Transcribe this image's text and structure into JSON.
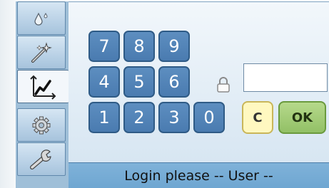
{
  "sidebar": {
    "items": [
      {
        "icon": "drops-icon",
        "active": false
      },
      {
        "icon": "magic-wand-icon",
        "active": false
      },
      {
        "icon": "line-chart-icon",
        "active": true
      },
      {
        "icon": "gear-icon",
        "active": false
      },
      {
        "icon": "wrench-icon",
        "active": false
      }
    ]
  },
  "keypad": {
    "keys": [
      "7",
      "8",
      "9",
      "4",
      "5",
      "6",
      "1",
      "2",
      "3",
      "0"
    ]
  },
  "login": {
    "lock_icon": "lock-icon",
    "password_value": "",
    "clear_label": "C",
    "ok_label": "OK"
  },
  "status": {
    "message": "Login please -- User --"
  },
  "colors": {
    "key_fill": "#5a8bbf",
    "clear_fill": "#fff8c0",
    "ok_fill": "#a6cf7a",
    "status_bar": "#78aed6",
    "sidebar": "#9fbfd8"
  }
}
